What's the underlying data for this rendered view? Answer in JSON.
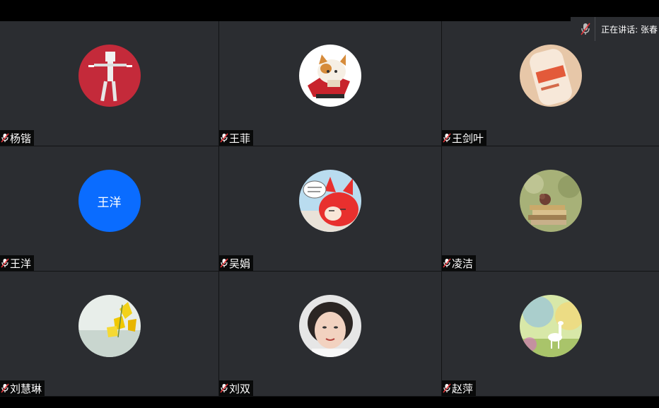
{
  "speaking": {
    "label": "正在讲话: 张春"
  },
  "participants": [
    {
      "name": "杨锴",
      "avatar": "photo-paper-figure",
      "muted": true
    },
    {
      "name": "王菲",
      "avatar": "photo-cat-cartoon",
      "muted": true
    },
    {
      "name": "王剑叶",
      "avatar": "photo-yogurt-bottle",
      "muted": true
    },
    {
      "name": "王洋",
      "avatar_text": "王洋",
      "avatar_color": "#0a6cff",
      "muted": true
    },
    {
      "name": "吴娟",
      "avatar": "photo-red-fox-cartoon",
      "muted": true
    },
    {
      "name": "凌洁",
      "avatar": "photo-books-bird",
      "muted": true
    },
    {
      "name": "刘慧琳",
      "avatar": "photo-yellow-flowers",
      "muted": true
    },
    {
      "name": "刘双",
      "avatar": "photo-woman-portrait",
      "muted": true
    },
    {
      "name": "赵萍",
      "avatar": "photo-alpaca-meadow",
      "muted": true
    }
  ],
  "icons": {
    "mic_muted": "microphone-muted-icon"
  },
  "colors": {
    "tile_bg": "#2b2d31",
    "mic_muted_red": "#e2363b",
    "name_tag_bg": "#000000"
  }
}
